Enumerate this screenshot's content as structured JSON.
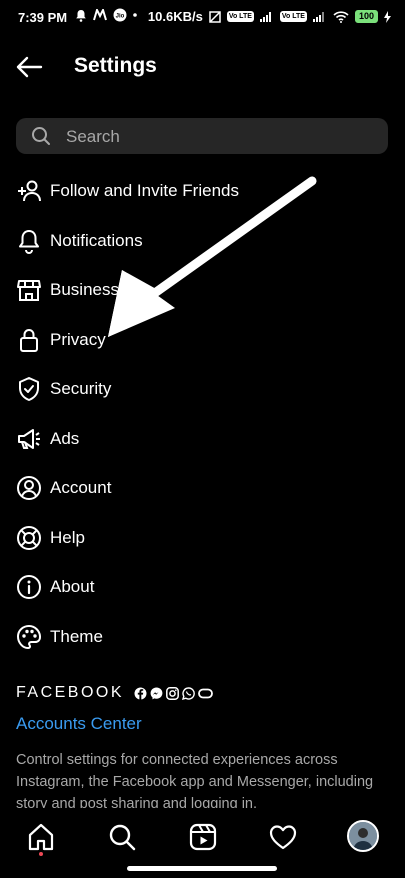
{
  "status_bar": {
    "time": "7:39 PM",
    "net_speed": "10.6KB/s",
    "vo_lte_1": "Vo LTE",
    "vo_lte_2": "Vo LTE",
    "battery": "100"
  },
  "header": {
    "title": "Settings"
  },
  "search": {
    "placeholder": "Search"
  },
  "menu": [
    {
      "label": "Follow and Invite Friends",
      "icon": "add-person-icon"
    },
    {
      "label": "Notifications",
      "icon": "bell-icon"
    },
    {
      "label": "Business",
      "icon": "store-icon"
    },
    {
      "label": "Privacy",
      "icon": "lock-icon"
    },
    {
      "label": "Security",
      "icon": "shield-check-icon"
    },
    {
      "label": "Ads",
      "icon": "megaphone-icon"
    },
    {
      "label": "Account",
      "icon": "person-circle-icon"
    },
    {
      "label": "Help",
      "icon": "lifebuoy-icon"
    },
    {
      "label": "About",
      "icon": "info-icon"
    },
    {
      "label": "Theme",
      "icon": "palette-icon"
    }
  ],
  "facebook": {
    "wordmark": "FACEBOOK",
    "accounts_center": "Accounts Center",
    "description": "Control settings for connected experiences across Instagram, the Facebook app and Messenger, including story and post sharing and logging in."
  },
  "nav": [
    "home-icon",
    "search-icon",
    "reels-icon",
    "heart-icon",
    "profile-avatar"
  ],
  "colors": {
    "link": "#3a9bf0",
    "search_bg": "#262626",
    "muted": "#a8a8a8",
    "notification_dot": "#ed4956"
  }
}
